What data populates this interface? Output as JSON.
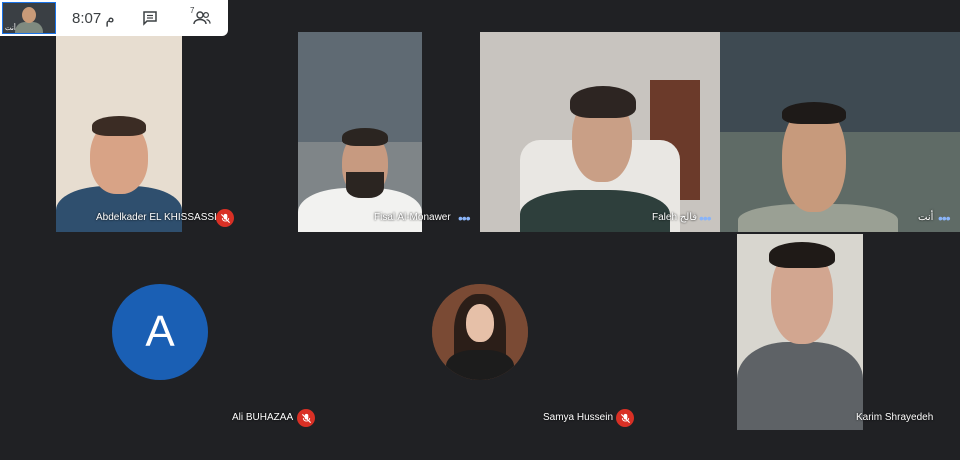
{
  "topbar": {
    "clock": "8:07 م",
    "self_label": "أنت",
    "people_count": "7"
  },
  "participants": [
    {
      "name": "Abdelkader EL KHISSASSI",
      "muted": true
    },
    {
      "name": "Fisal Al-Monawer",
      "muted": false
    },
    {
      "name": "Faleh فالح",
      "muted": false
    },
    {
      "name": "أنت",
      "muted": false
    },
    {
      "name": "Ali BUHAZAA",
      "muted": true,
      "avatar_letter": "A"
    },
    {
      "name": "Samya Hussein",
      "muted": true
    },
    {
      "name": "Karim Shrayedeh",
      "muted": false
    }
  ],
  "icons": {
    "chat": "chat-icon",
    "people": "people-icon",
    "mic_off": "mic-off-icon",
    "more": "more-options-icon"
  },
  "colors": {
    "background": "#202124",
    "mic_off": "#d93025",
    "avatar": "#1a5fb4",
    "dots": "#8ab4f8"
  }
}
